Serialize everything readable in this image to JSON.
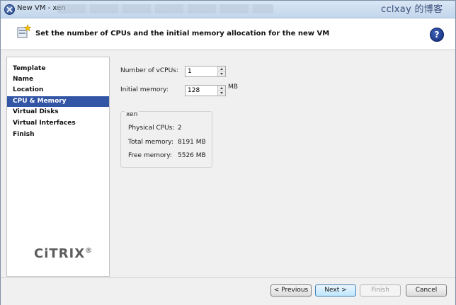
{
  "window": {
    "title": "New VM - xen",
    "watermark": "cclxay 的博客"
  },
  "header": {
    "title": "Set the number of CPUs and the initial memory allocation for the new VM",
    "help_glyph": "?"
  },
  "nav": {
    "items": [
      {
        "label": "Template",
        "active": false
      },
      {
        "label": "Name",
        "active": false
      },
      {
        "label": "Location",
        "active": false
      },
      {
        "label": "CPU & Memory",
        "active": true
      },
      {
        "label": "Virtual Disks",
        "active": false
      },
      {
        "label": "Virtual Interfaces",
        "active": false
      },
      {
        "label": "Finish",
        "active": false
      }
    ],
    "logo": "CiTRIX"
  },
  "form": {
    "vcpus_label": "Number of vCPUs:",
    "vcpus_value": "1",
    "memory_label": "Initial memory:",
    "memory_value": "128",
    "memory_unit": "MB"
  },
  "host": {
    "name": "xen",
    "rows": [
      {
        "label": "Physical CPUs:",
        "value": "2"
      },
      {
        "label": "Total memory:",
        "value": "8191 MB"
      },
      {
        "label": "Free memory:",
        "value": "5526 MB"
      }
    ]
  },
  "footer": {
    "previous": "< Previous",
    "next": "Next >",
    "finish": "Finish",
    "cancel": "Cancel"
  },
  "colors": {
    "nav_active": "#3355a6",
    "help_icon": "#1b3d8f"
  }
}
